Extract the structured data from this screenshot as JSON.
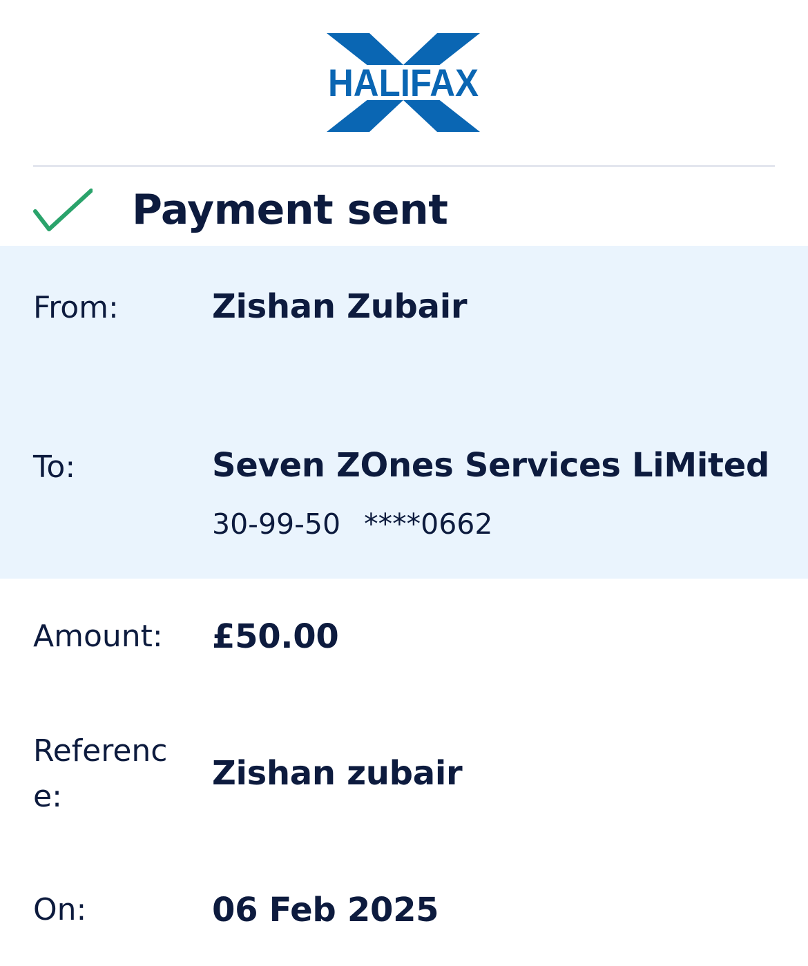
{
  "brand": {
    "logo_text": "HALIFAX",
    "logo_color": "#0a66b3"
  },
  "status": {
    "icon": "checkmark-icon",
    "icon_color": "#2aa36b",
    "title": "Payment sent"
  },
  "details": {
    "from": {
      "label": "From:",
      "value": "Zishan Zubair"
    },
    "to": {
      "label": "To:",
      "value": "Seven ZOnes Services LiMited",
      "sort_code": "30-99-50",
      "account": "****0662"
    },
    "amount": {
      "label": "Amount:",
      "value": "£50.00"
    },
    "reference": {
      "label": "Reference:",
      "value": "Zishan zubair"
    },
    "on": {
      "label": "On:",
      "value": "06 Feb 2025"
    }
  },
  "colors": {
    "text": "#0d1b3e",
    "highlight_band": "#eaf4fd",
    "divider": "#e3e6ee"
  }
}
